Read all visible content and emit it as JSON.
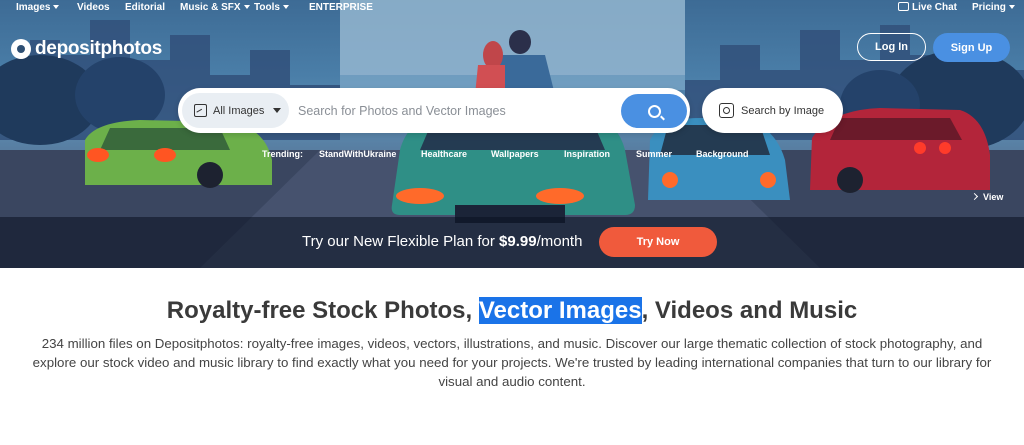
{
  "nav": {
    "items": [
      {
        "label": "Images",
        "has_caret": true
      },
      {
        "label": "Videos",
        "has_caret": false
      },
      {
        "label": "Editorial",
        "has_caret": false
      },
      {
        "label": "Music & SFX",
        "has_caret": true
      },
      {
        "label": "Tools",
        "has_caret": true
      },
      {
        "label": "ENTERPRISE",
        "has_caret": false
      }
    ],
    "live_chat": "Live Chat",
    "pricing": "Pricing"
  },
  "logo": {
    "text": "depositphotos"
  },
  "auth": {
    "login": "Log In",
    "signup": "Sign Up"
  },
  "search": {
    "type_label": "All Images",
    "placeholder": "Search for Photos and Vector Images",
    "value": "",
    "by_image_label": "Search by Image"
  },
  "trending": {
    "label": "Trending:",
    "tags": [
      "StandWithUkraine",
      "Healthcare",
      "Wallpapers",
      "Inspiration",
      "Summer",
      "Background"
    ]
  },
  "view_label": "View",
  "promo": {
    "prefix": "Try our New Flexible Plan for ",
    "price": "$9.99",
    "suffix": "/month",
    "cta": "Try Now"
  },
  "content": {
    "title_before": "Royalty-free Stock Photos, ",
    "title_highlight": "Vector Images",
    "title_after": ", Videos and Music",
    "description": "234 million files on Depositphotos: royalty-free images, videos, vectors, illustrations, and music. Discover our large thematic collection of stock photography, and explore our stock video and music library to find exactly what you need for your projects. We're trusted by leading international companies that turn to our library for visual and audio content."
  },
  "colors": {
    "accent_blue": "#4a90e2",
    "cta_orange": "#f05a3c",
    "highlight": "#1a73e8"
  }
}
